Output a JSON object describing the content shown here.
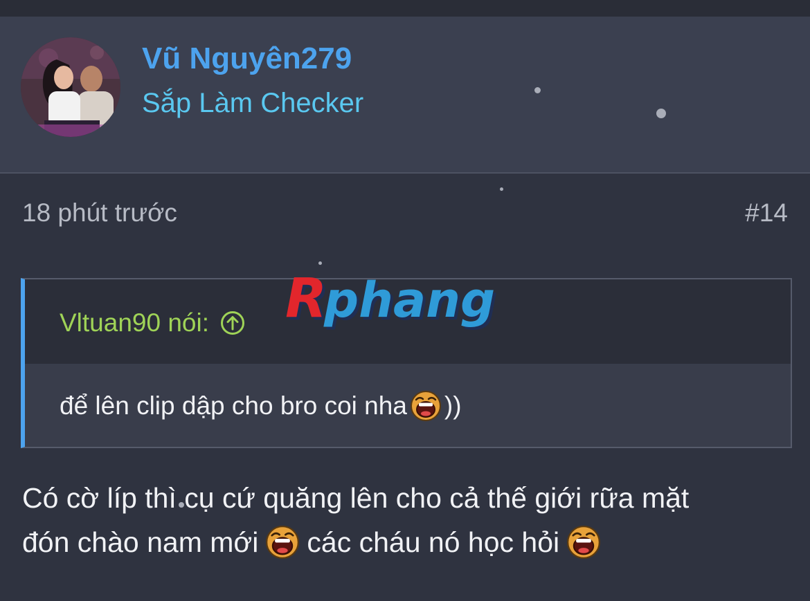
{
  "user": {
    "name": "Vũ Nguyên279",
    "title": "Sắp Làm Checker"
  },
  "post": {
    "time": "18 phút trước",
    "number": "#14"
  },
  "quote": {
    "author": "Vltuan90 nói:",
    "text": "để lên clip dập cho bro coi nha",
    "trailing": "))"
  },
  "message": {
    "line1": "Có cờ líp thì cụ cứ quăng lên cho cả thế giới rữa mặt",
    "line2_part1": "đón chào nam mới",
    "line2_part2": "các cháu nó học hỏi"
  },
  "watermark": {
    "text": "Rphang"
  },
  "colors": {
    "username": "#4da3ee",
    "user_title": "#5ac8f0",
    "quote_author": "#9fd357",
    "quote_bar": "#4da3ee",
    "background": "#2f3340"
  },
  "icons": {
    "quote_jump": "arrow-up-circle-icon",
    "emoji": "laughing-emoji-icon"
  }
}
